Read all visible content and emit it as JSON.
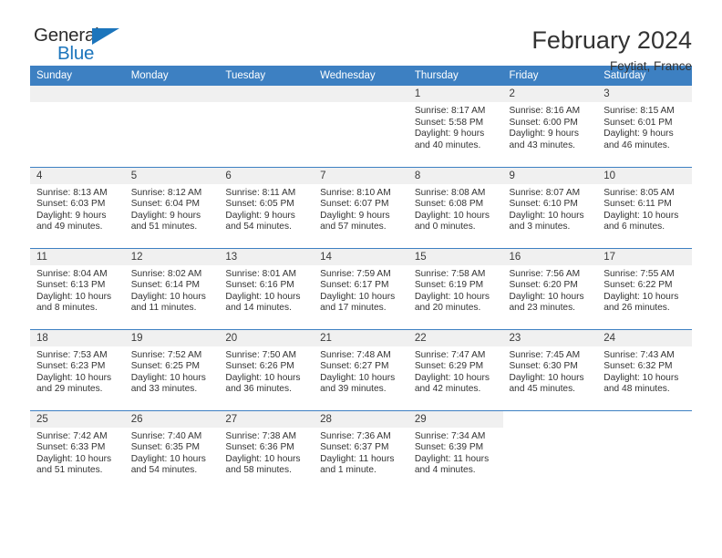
{
  "brand": {
    "name_part1": "General",
    "name_part2": "Blue",
    "triangle_color": "#1c75bc"
  },
  "header": {
    "title": "February 2024",
    "subtitle": "Feytiat, France"
  },
  "theme": {
    "header_blue": "#3d80c2",
    "daynum_band": "#f0f0f0",
    "text": "#333333"
  },
  "calendar": {
    "weekday_headers": [
      "Sunday",
      "Monday",
      "Tuesday",
      "Wednesday",
      "Thursday",
      "Friday",
      "Saturday"
    ],
    "weeks": [
      [
        {
          "day": "",
          "empty": true
        },
        {
          "day": "",
          "empty": true
        },
        {
          "day": "",
          "empty": true
        },
        {
          "day": "",
          "empty": true
        },
        {
          "day": "1",
          "sunrise": "Sunrise: 8:17 AM",
          "sunset": "Sunset: 5:58 PM",
          "daylight1": "Daylight: 9 hours",
          "daylight2": "and 40 minutes."
        },
        {
          "day": "2",
          "sunrise": "Sunrise: 8:16 AM",
          "sunset": "Sunset: 6:00 PM",
          "daylight1": "Daylight: 9 hours",
          "daylight2": "and 43 minutes."
        },
        {
          "day": "3",
          "sunrise": "Sunrise: 8:15 AM",
          "sunset": "Sunset: 6:01 PM",
          "daylight1": "Daylight: 9 hours",
          "daylight2": "and 46 minutes."
        }
      ],
      [
        {
          "day": "4",
          "sunrise": "Sunrise: 8:13 AM",
          "sunset": "Sunset: 6:03 PM",
          "daylight1": "Daylight: 9 hours",
          "daylight2": "and 49 minutes."
        },
        {
          "day": "5",
          "sunrise": "Sunrise: 8:12 AM",
          "sunset": "Sunset: 6:04 PM",
          "daylight1": "Daylight: 9 hours",
          "daylight2": "and 51 minutes."
        },
        {
          "day": "6",
          "sunrise": "Sunrise: 8:11 AM",
          "sunset": "Sunset: 6:05 PM",
          "daylight1": "Daylight: 9 hours",
          "daylight2": "and 54 minutes."
        },
        {
          "day": "7",
          "sunrise": "Sunrise: 8:10 AM",
          "sunset": "Sunset: 6:07 PM",
          "daylight1": "Daylight: 9 hours",
          "daylight2": "and 57 minutes."
        },
        {
          "day": "8",
          "sunrise": "Sunrise: 8:08 AM",
          "sunset": "Sunset: 6:08 PM",
          "daylight1": "Daylight: 10 hours",
          "daylight2": "and 0 minutes."
        },
        {
          "day": "9",
          "sunrise": "Sunrise: 8:07 AM",
          "sunset": "Sunset: 6:10 PM",
          "daylight1": "Daylight: 10 hours",
          "daylight2": "and 3 minutes."
        },
        {
          "day": "10",
          "sunrise": "Sunrise: 8:05 AM",
          "sunset": "Sunset: 6:11 PM",
          "daylight1": "Daylight: 10 hours",
          "daylight2": "and 6 minutes."
        }
      ],
      [
        {
          "day": "11",
          "sunrise": "Sunrise: 8:04 AM",
          "sunset": "Sunset: 6:13 PM",
          "daylight1": "Daylight: 10 hours",
          "daylight2": "and 8 minutes."
        },
        {
          "day": "12",
          "sunrise": "Sunrise: 8:02 AM",
          "sunset": "Sunset: 6:14 PM",
          "daylight1": "Daylight: 10 hours",
          "daylight2": "and 11 minutes."
        },
        {
          "day": "13",
          "sunrise": "Sunrise: 8:01 AM",
          "sunset": "Sunset: 6:16 PM",
          "daylight1": "Daylight: 10 hours",
          "daylight2": "and 14 minutes."
        },
        {
          "day": "14",
          "sunrise": "Sunrise: 7:59 AM",
          "sunset": "Sunset: 6:17 PM",
          "daylight1": "Daylight: 10 hours",
          "daylight2": "and 17 minutes."
        },
        {
          "day": "15",
          "sunrise": "Sunrise: 7:58 AM",
          "sunset": "Sunset: 6:19 PM",
          "daylight1": "Daylight: 10 hours",
          "daylight2": "and 20 minutes."
        },
        {
          "day": "16",
          "sunrise": "Sunrise: 7:56 AM",
          "sunset": "Sunset: 6:20 PM",
          "daylight1": "Daylight: 10 hours",
          "daylight2": "and 23 minutes."
        },
        {
          "day": "17",
          "sunrise": "Sunrise: 7:55 AM",
          "sunset": "Sunset: 6:22 PM",
          "daylight1": "Daylight: 10 hours",
          "daylight2": "and 26 minutes."
        }
      ],
      [
        {
          "day": "18",
          "sunrise": "Sunrise: 7:53 AM",
          "sunset": "Sunset: 6:23 PM",
          "daylight1": "Daylight: 10 hours",
          "daylight2": "and 29 minutes."
        },
        {
          "day": "19",
          "sunrise": "Sunrise: 7:52 AM",
          "sunset": "Sunset: 6:25 PM",
          "daylight1": "Daylight: 10 hours",
          "daylight2": "and 33 minutes."
        },
        {
          "day": "20",
          "sunrise": "Sunrise: 7:50 AM",
          "sunset": "Sunset: 6:26 PM",
          "daylight1": "Daylight: 10 hours",
          "daylight2": "and 36 minutes."
        },
        {
          "day": "21",
          "sunrise": "Sunrise: 7:48 AM",
          "sunset": "Sunset: 6:27 PM",
          "daylight1": "Daylight: 10 hours",
          "daylight2": "and 39 minutes."
        },
        {
          "day": "22",
          "sunrise": "Sunrise: 7:47 AM",
          "sunset": "Sunset: 6:29 PM",
          "daylight1": "Daylight: 10 hours",
          "daylight2": "and 42 minutes."
        },
        {
          "day": "23",
          "sunrise": "Sunrise: 7:45 AM",
          "sunset": "Sunset: 6:30 PM",
          "daylight1": "Daylight: 10 hours",
          "daylight2": "and 45 minutes."
        },
        {
          "day": "24",
          "sunrise": "Sunrise: 7:43 AM",
          "sunset": "Sunset: 6:32 PM",
          "daylight1": "Daylight: 10 hours",
          "daylight2": "and 48 minutes."
        }
      ],
      [
        {
          "day": "25",
          "sunrise": "Sunrise: 7:42 AM",
          "sunset": "Sunset: 6:33 PM",
          "daylight1": "Daylight: 10 hours",
          "daylight2": "and 51 minutes."
        },
        {
          "day": "26",
          "sunrise": "Sunrise: 7:40 AM",
          "sunset": "Sunset: 6:35 PM",
          "daylight1": "Daylight: 10 hours",
          "daylight2": "and 54 minutes."
        },
        {
          "day": "27",
          "sunrise": "Sunrise: 7:38 AM",
          "sunset": "Sunset: 6:36 PM",
          "daylight1": "Daylight: 10 hours",
          "daylight2": "and 58 minutes."
        },
        {
          "day": "28",
          "sunrise": "Sunrise: 7:36 AM",
          "sunset": "Sunset: 6:37 PM",
          "daylight1": "Daylight: 11 hours",
          "daylight2": "and 1 minute."
        },
        {
          "day": "29",
          "sunrise": "Sunrise: 7:34 AM",
          "sunset": "Sunset: 6:39 PM",
          "daylight1": "Daylight: 11 hours",
          "daylight2": "and 4 minutes."
        },
        {
          "day": "",
          "empty": true,
          "blank": true
        },
        {
          "day": "",
          "empty": true,
          "blank": true
        }
      ]
    ]
  }
}
